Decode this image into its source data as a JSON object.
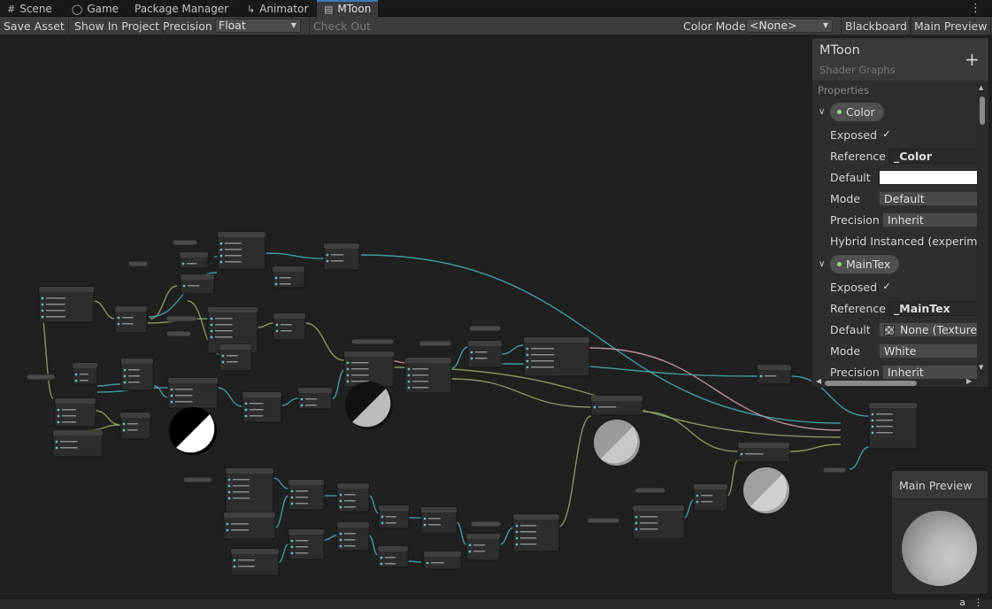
{
  "tabs": [
    {
      "label": "Scene",
      "icon": "grid-icon"
    },
    {
      "label": "Game",
      "icon": "gamepad-icon"
    },
    {
      "label": "Package Manager",
      "icon": ""
    },
    {
      "label": "Animator",
      "icon": "animator-icon"
    },
    {
      "label": "MToon",
      "icon": "shader-graph-icon",
      "active": true
    }
  ],
  "toolbar": {
    "save_asset": "Save Asset",
    "show_in_project": "Show In Project",
    "precision_label": "Precision",
    "precision_value": "Float",
    "check_out": "Check Out",
    "color_mode_label": "Color Mode",
    "color_mode_value": "<None>",
    "blackboard": "Blackboard",
    "main_preview": "Main Preview"
  },
  "blackboard": {
    "title": "MToon",
    "subtitle": "Shader Graphs",
    "section": "Properties",
    "properties": [
      {
        "name": "Color",
        "exposed_label": "Exposed",
        "exposed": true,
        "reference_label": "Reference",
        "reference": "_Color",
        "default_label": "Default",
        "default_color": "#ffffff",
        "mode_label": "Mode",
        "mode": "Default",
        "precision_label": "Precision",
        "precision": "Inherit",
        "hybrid_label": "Hybrid Instanced (experimen"
      },
      {
        "name": "MainTex",
        "exposed_label": "Exposed",
        "exposed": true,
        "reference_label": "Reference",
        "reference": "_MainTex",
        "default_label": "Default",
        "default_value": "None (Texture",
        "mode_label": "Mode",
        "mode": "White",
        "precision_label": "Precision",
        "precision": "Inherit"
      }
    ]
  },
  "main_preview_panel": {
    "title": "Main Preview"
  },
  "colors": {
    "accent_tab": "#3a79bb",
    "edge_vector": "#4aa3a8",
    "edge_float": "#8fa06a",
    "edge_texture": "#c79aa9",
    "property_dot": "#8ee07f"
  }
}
